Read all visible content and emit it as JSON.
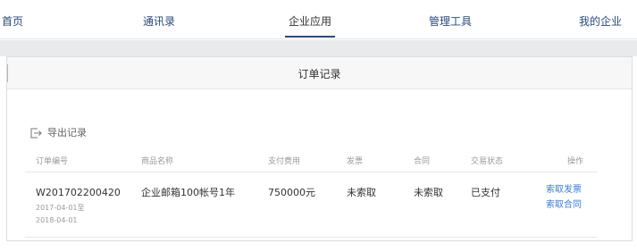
{
  "nav": {
    "items": [
      "首页",
      "通讯录",
      "企业应用",
      "管理工具",
      "我的企业"
    ],
    "active_index": 2
  },
  "panel": {
    "title": "订单记录",
    "export_label": "导出记录",
    "export_icon": "export-icon"
  },
  "table": {
    "columns": [
      "订单编号",
      "商品名称",
      "支付费用",
      "发票",
      "合同",
      "交易状态",
      "操作"
    ],
    "rows": [
      {
        "order_no": "W201702200420",
        "date_start": "2017-04-01至",
        "date_end": "2018-04-01",
        "product": "企业邮箱100帐号1年",
        "fee": "750000元",
        "invoice": "未索取",
        "contract": "未索取",
        "status": "已支付",
        "actions": [
          "索取发票",
          "索取合同"
        ]
      }
    ]
  },
  "colors": {
    "nav_text": "#2b4a7a",
    "link": "#3a7bd5",
    "strip": "#e9eaec"
  }
}
